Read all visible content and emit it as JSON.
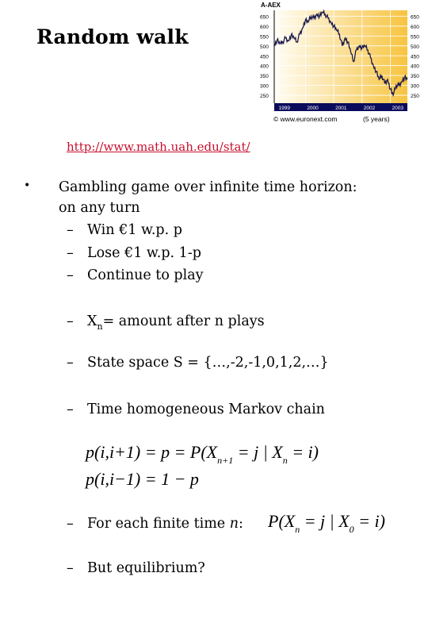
{
  "slide": {
    "title": "Random walk",
    "link": "http://www.math.uah.edu/stat/",
    "bullet_symbol": "•",
    "dash_symbol": "–",
    "bullet_text_line1": "Gambling game over infinite time horizon:",
    "bullet_text_line2": "on any turn",
    "sub_items": [
      "Win €1 w.p. p",
      "Lose €1 w.p. 1-p",
      "Continue to play"
    ],
    "xn_var": "X",
    "xn_sub": "n",
    "xn_text": "= amount after n plays",
    "state_space": "State space S = {…,-2,-1,0,1,2,…}",
    "markov": "Time homogeneous Markov chain",
    "formula1_left": "p(i,i+1) = p = P(X",
    "formula1_sub1": "n+1",
    "formula1_mid": " = j | X",
    "formula1_sub2": "n",
    "formula1_end": " = i)",
    "formula2": "p(i,i−1) = 1 − p",
    "finite_time_prefix": "For each finite time ",
    "finite_time_var": "n",
    "finite_time_suffix": ":",
    "formula3_left": "P(X",
    "formula3_sub1": "n",
    "formula3_mid": " = j | X",
    "formula3_sub2": "0",
    "formula3_end": " = i)",
    "equilibrium": "But equilibrium?"
  },
  "chart_data": {
    "type": "line",
    "title": "A-AEX",
    "source": "© www.euronext.com",
    "period_note": "(5 years)",
    "x_tick_labels": [
      "1999",
      "2000",
      "2001",
      "2002",
      "2003"
    ],
    "y_tick_labels_left": [
      "650",
      "600",
      "550",
      "500",
      "450",
      "400",
      "350",
      "300",
      "250"
    ],
    "y_tick_labels_right": [
      "650",
      "600",
      "550",
      "500",
      "450",
      "400",
      "350",
      "300",
      "250"
    ],
    "ylim": [
      210,
      680
    ],
    "xlim": [
      1998.9,
      2003.6
    ],
    "grid": true,
    "colors": {
      "line": "#1a1a4e",
      "axis_band": "#0b0b5c",
      "bg_start": "#fffdf5",
      "bg_end": "#f7c440"
    },
    "series": [
      {
        "name": "AEX",
        "x": [
          1998.9,
          1999.0,
          1999.1,
          1999.2,
          1999.3,
          1999.4,
          1999.5,
          1999.6,
          1999.7,
          1999.8,
          1999.9,
          2000.0,
          2000.1,
          2000.2,
          2000.3,
          2000.4,
          2000.5,
          2000.6,
          2000.7,
          2000.8,
          2000.9,
          2001.0,
          2001.1,
          2001.2,
          2001.3,
          2001.4,
          2001.5,
          2001.6,
          2001.7,
          2001.8,
          2001.9,
          2002.0,
          2002.1,
          2002.2,
          2002.3,
          2002.4,
          2002.5,
          2002.6,
          2002.7,
          2002.8,
          2002.9,
          2003.0,
          2003.1,
          2003.2,
          2003.3,
          2003.4,
          2003.5,
          2003.6
        ],
        "values": [
          500,
          530,
          510,
          520,
          540,
          525,
          555,
          540,
          520,
          560,
          590,
          630,
          620,
          650,
          640,
          660,
          650,
          670,
          660,
          640,
          620,
          600,
          580,
          560,
          500,
          540,
          520,
          470,
          420,
          480,
          500,
          490,
          500,
          480,
          440,
          400,
          370,
          330,
          350,
          310,
          330,
          280,
          250,
          300,
          300,
          320,
          340,
          330
        ]
      }
    ]
  }
}
